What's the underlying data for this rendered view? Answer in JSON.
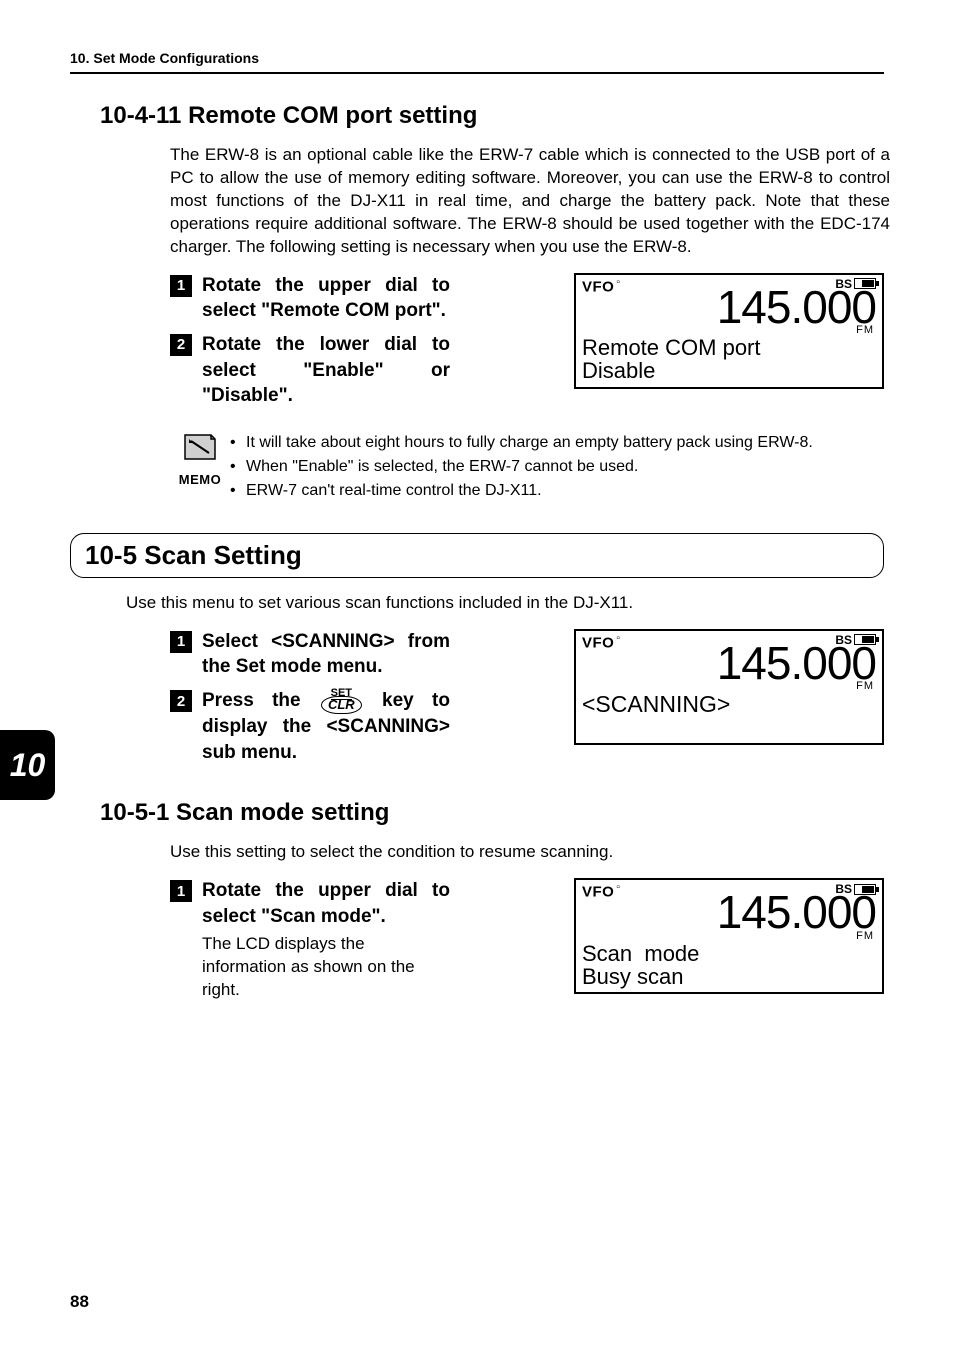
{
  "header": "10. Set Mode Configurations",
  "pageNumber": "88",
  "sideTab": "10",
  "s10411": {
    "heading": "10-4-11 Remote COM port setting",
    "body": "The ERW-8 is an optional cable like the ERW-7 cable which is connected to the USB port of a PC to allow the use of memory editing software. Moreover, you can use the ERW-8 to control most functions of the DJ-X11 in real time, and charge the battery pack. Note that these operations require additional software. The ERW-8 should be used together with the EDC-174 charger. The following setting is necessary when you use the ERW-8.",
    "steps": [
      "Rotate the upper dial to select \"Remote COM port\".",
      "Rotate the lower dial to select \"Enable\" or \"Disable\"."
    ],
    "lcd": {
      "vfo": "VFO",
      "bs": "BS",
      "freq": "145.000",
      "fm": "FM",
      "line1": "Remote COM port",
      "line2": "Disable"
    },
    "memoLabel": "MEMO",
    "memo": [
      "It will take about eight hours to fully charge an empty battery pack using ERW-8.",
      "When \"Enable\" is selected, the ERW-7 cannot be used.",
      "ERW-7 can't real-time control the DJ-X11."
    ]
  },
  "s105": {
    "heading": "10-5 Scan Setting",
    "intro": "Use this menu to set various scan functions included in the DJ-X11.",
    "step1": "Select <SCANNING> from the Set mode menu.",
    "step2_a": "Press the ",
    "step2_set": "SET",
    "step2_clr": "CLR",
    "step2_b": " key to display the <SCANNING> sub menu.",
    "lcd": {
      "vfo": "VFO",
      "bs": "BS",
      "freq": "145.000",
      "fm": "FM",
      "line1": "<SCANNING>"
    }
  },
  "s1051": {
    "heading": "10-5-1 Scan mode setting",
    "intro": "Use this setting to select the condition to resume scanning.",
    "step1": "Rotate the upper dial to select \"Scan mode\".",
    "step1sub": "The LCD displays the information as shown on the right.",
    "lcd": {
      "vfo": "VFO",
      "bs": "BS",
      "freq": "145.000",
      "fm": "FM",
      "line1": "Scan  mode",
      "line2": "Busy scan"
    }
  }
}
